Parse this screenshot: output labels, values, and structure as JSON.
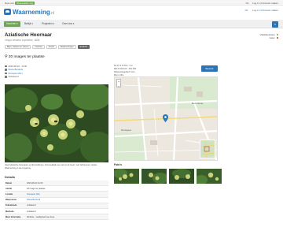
{
  "topbar": {
    "left_prefix": "Deel ook",
    "left_badge": "Observation.org",
    "right": [
      "NL",
      "Log in of Account maken"
    ]
  },
  "header": {
    "logo": "Waarneming",
    "logo_suffix": ".nl",
    "right_links": [
      "NL",
      "Log in of Account maken"
    ]
  },
  "nav": {
    "items": [
      "Invoeren ▾",
      "Bekijk ▾",
      "Projecten ▾",
      "Over ons ▾"
    ],
    "search_icon": "search-icon"
  },
  "species": {
    "name": "Aziatische Hoornaar",
    "scientific": "Vespa velutina",
    "author": "Lepeletier, 1836"
  },
  "validation": {
    "line1": "Validatiestatus",
    "line2": "zeker"
  },
  "tags": [
    "Bijen, wespen en mieren",
    "Insecten",
    "Vespa",
    "Waarnemingen",
    "Exotisch"
  ],
  "photos_heading": "20 images ter plaatse",
  "meta_left": {
    "date": "2023-08-23 · 11:00",
    "user": "Diana Burdonk",
    "place": "Nunspeet (NL)",
    "status": "Onbekend"
  },
  "meta_mid": {
    "coords": "52.37 N 5.78 E · 5 m",
    "rd": "RD-X 183.123 · 481.456",
    "ref": "Referentiegebied: 6 km",
    "source": "Bron: iObs"
  },
  "share_button": "Bewerk",
  "caption": "Veel Aziatische hoornaars op dit bosklimop. Vermoedelijk een nest in de buurt, niet zelf kunnen vinden. Waarneming in de omgeving.",
  "details": {
    "heading": "Details",
    "rows": [
      {
        "k": "Datum",
        "v": "2023-08-23 11:00",
        "link": false
      },
      {
        "k": "Aantal",
        "v": "20 imago ter plaatse",
        "link": false
      },
      {
        "k": "Locatie",
        "v": "Nunspeet (NL)",
        "link": true
      },
      {
        "k": "Waarnemer",
        "v": "Diana Burdonk",
        "link": true
      },
      {
        "k": "Telmethode",
        "v": "onbekend",
        "link": false
      },
      {
        "k": "Methode",
        "v": "onbekend",
        "link": false
      },
      {
        "k": "Meer informatie",
        "v": "Website · Geldigheid van deze",
        "link": false
      }
    ]
  },
  "map": {
    "zoom_in": "+",
    "zoom_out": "−",
    "labels": [
      "Den Oever",
      "Nunspeet"
    ]
  },
  "fotos_heading": "Foto's",
  "colors": {
    "accent_green": "#6aa84f",
    "brand_blue": "#2c74b3"
  }
}
